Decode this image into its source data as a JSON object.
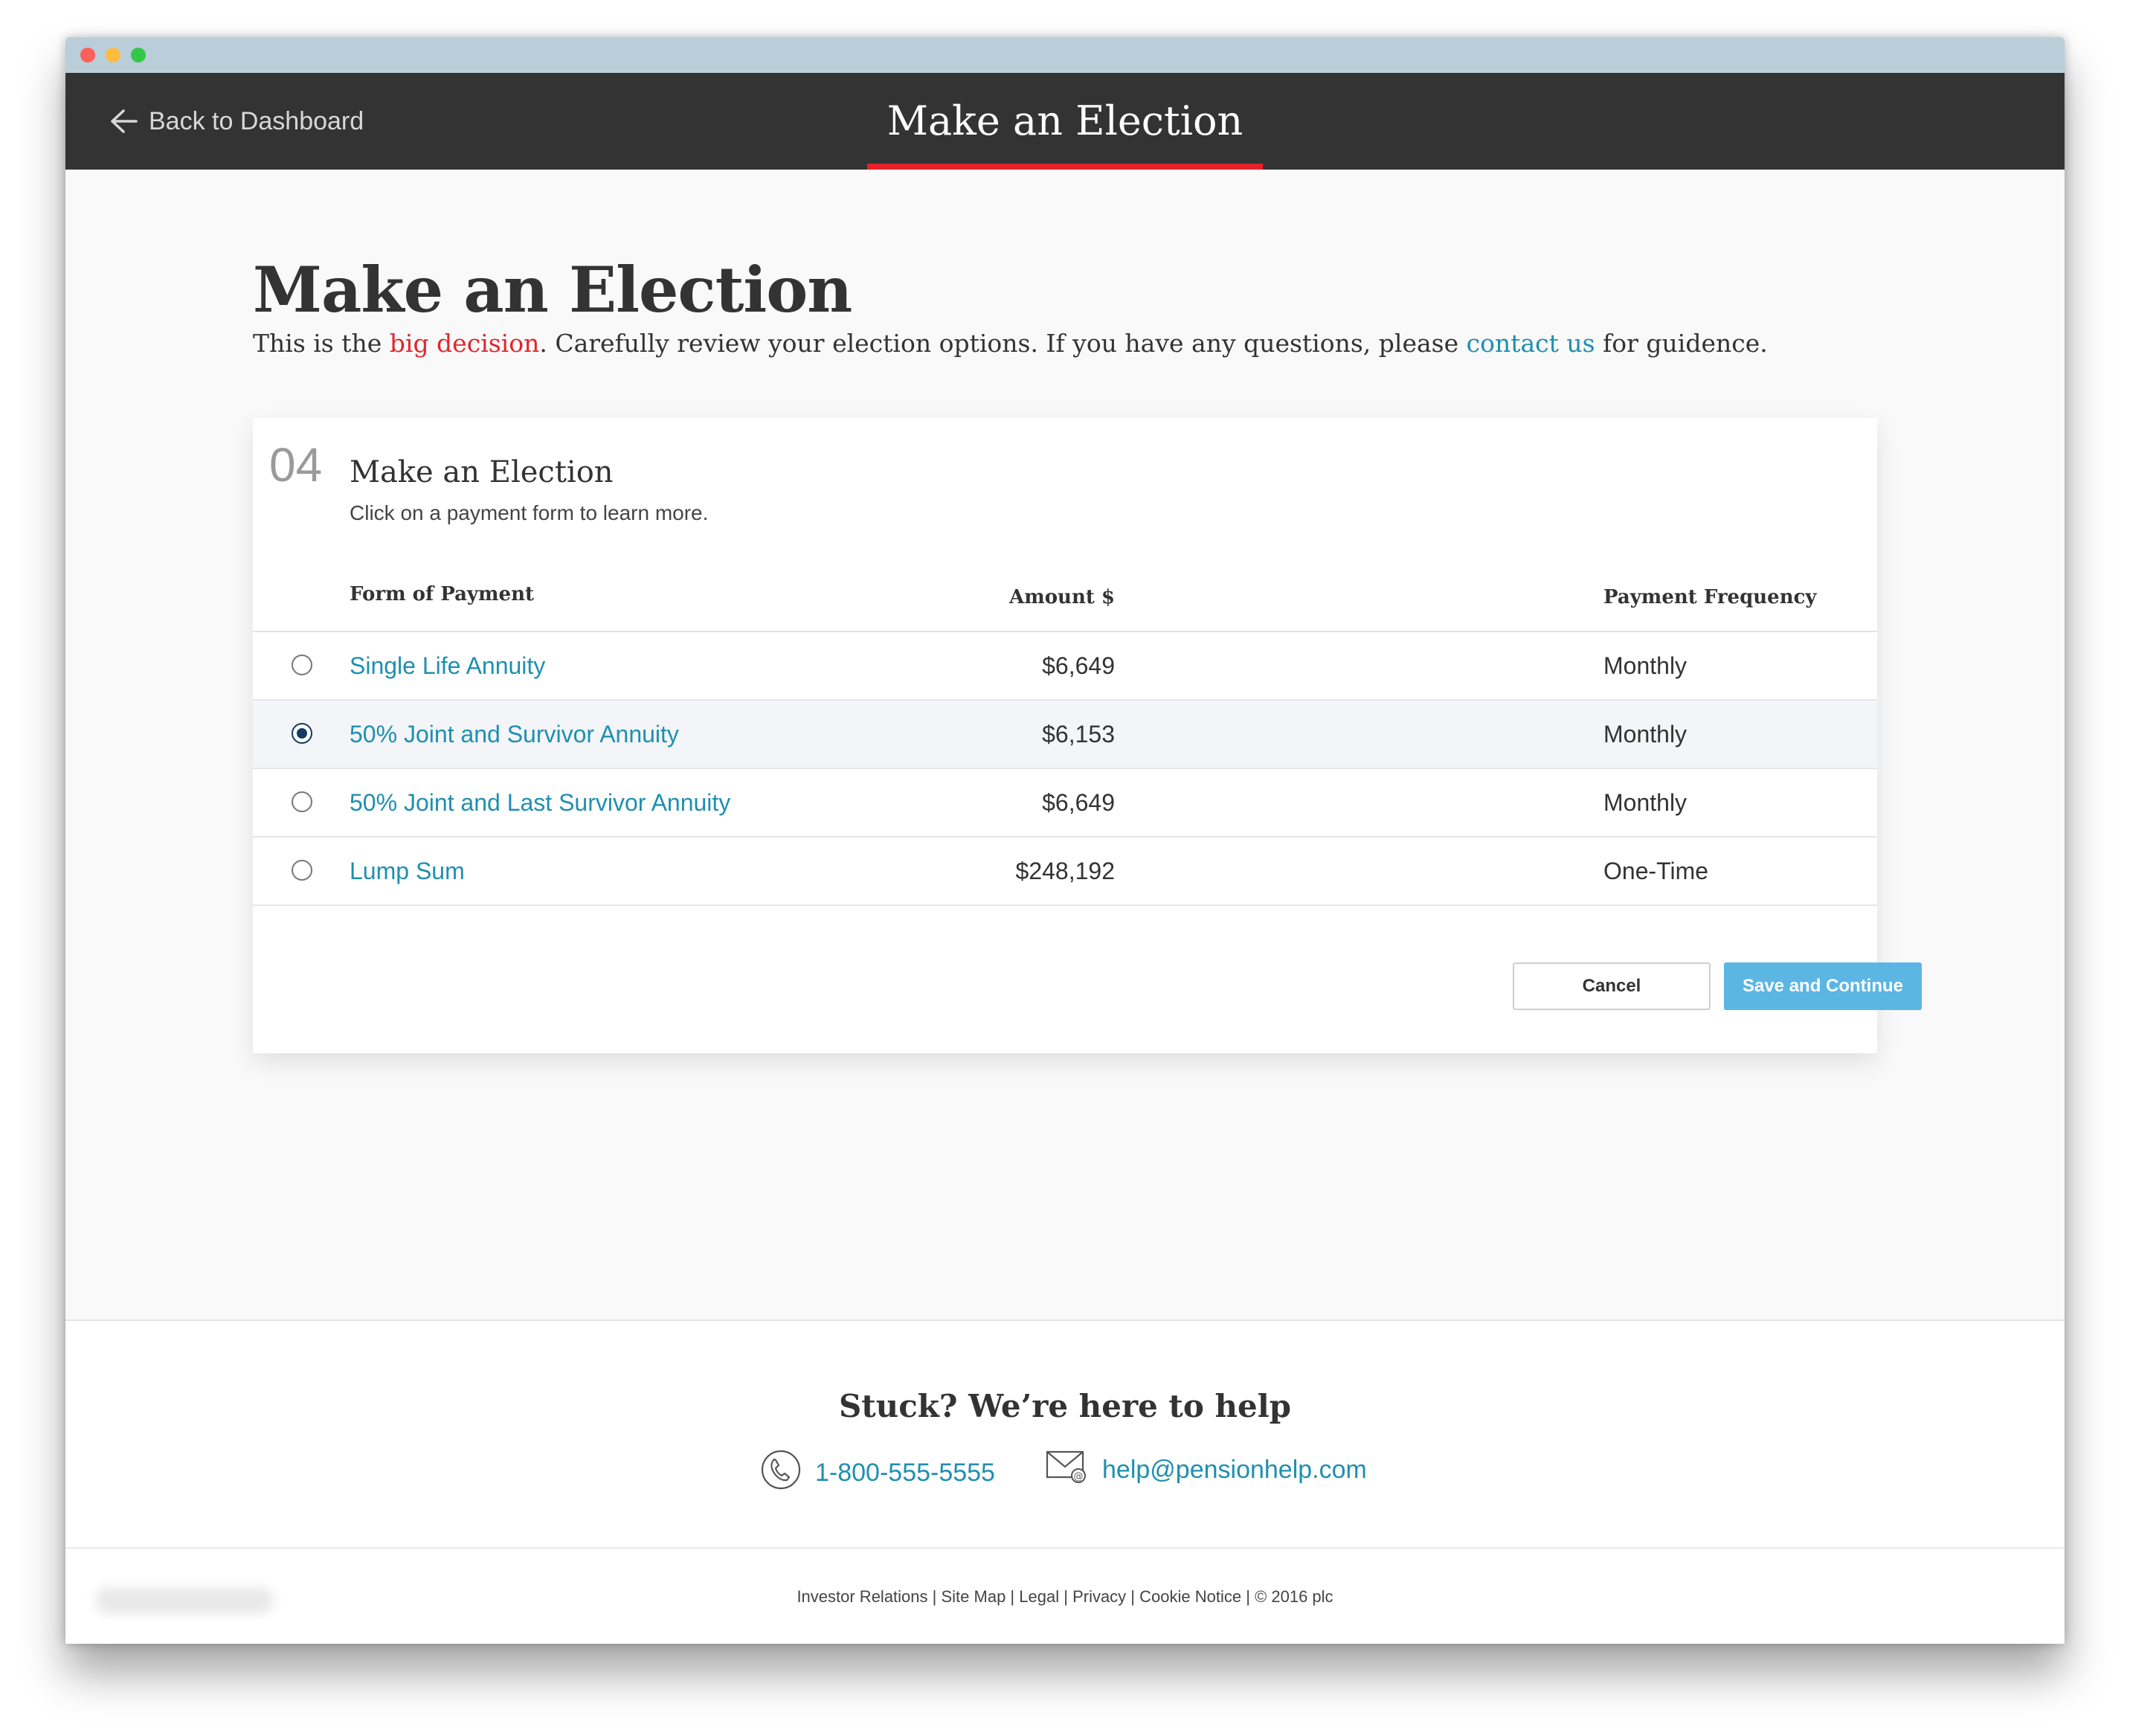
{
  "nav": {
    "back_label": "Back to Dashboard",
    "title": "Make an Election"
  },
  "page": {
    "title": "Make an Election",
    "intro_before": "This is the ",
    "intro_highlight": "big decision",
    "intro_middle": ".  Carefully review your election options.  If you have any questions, please ",
    "intro_link": "contact us",
    "intro_after": " for guidence."
  },
  "card": {
    "step_number": "04",
    "title": "Make an Election",
    "subtitle": "Click on a payment form to learn more.",
    "columns": {
      "form": "Form of Payment",
      "amount": "Amount $",
      "frequency": "Payment Frequency"
    },
    "rows": [
      {
        "name": "Single Life Annuity",
        "amount": "$6,649",
        "frequency": "Monthly",
        "selected": false
      },
      {
        "name": "50% Joint and Survivor Annuity",
        "amount": "$6,153",
        "frequency": "Monthly",
        "selected": true
      },
      {
        "name": "50% Joint and Last Survivor Annuity",
        "amount": "$6,649",
        "frequency": "Monthly",
        "selected": false
      },
      {
        "name": "Lump Sum",
        "amount": "$248,192",
        "frequency": "One-Time",
        "selected": false
      }
    ],
    "cancel_label": "Cancel",
    "save_label": "Save and Continue"
  },
  "help": {
    "title": "Stuck? We’re here to help",
    "phone": "1-800-555-5555",
    "email": "help@pensionhelp.com"
  },
  "footer": {
    "links": [
      "Investor Relations",
      "Site Map",
      "Legal",
      "Privacy",
      "Cookie Notice",
      "© 2016 plc"
    ]
  },
  "colors": {
    "accent_red": "#e8202a",
    "link_blue": "#1f8fb0",
    "button_blue": "#5bb6e4",
    "nav_bg": "#333333"
  }
}
